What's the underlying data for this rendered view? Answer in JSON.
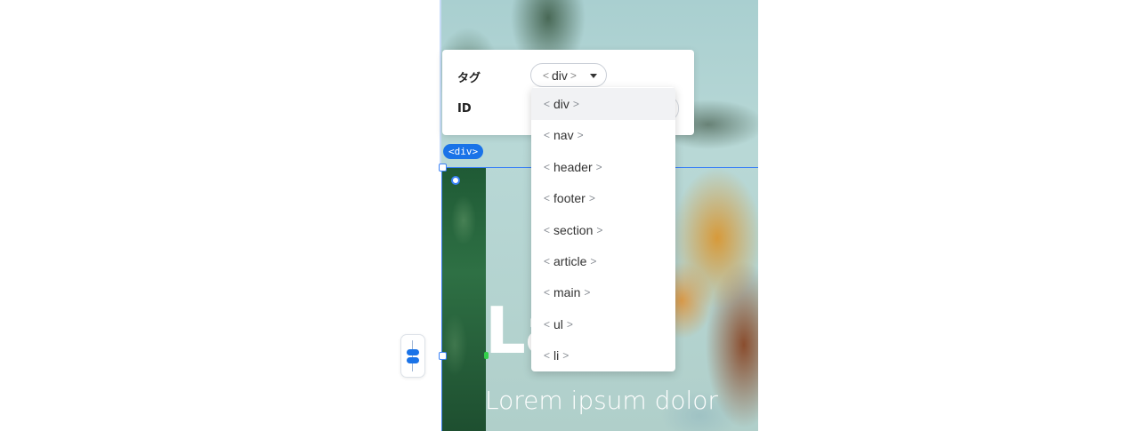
{
  "panel": {
    "tag_label": "タグ",
    "id_label": "ID",
    "selected_tag": "div",
    "bracket_open": "<",
    "bracket_close": ">"
  },
  "dropdown": {
    "options": [
      "div",
      "nav",
      "header",
      "footer",
      "section",
      "article",
      "main",
      "ul",
      "li"
    ],
    "active_index": 0
  },
  "element_badge": "<div>",
  "hero": {
    "headline": "La",
    "subtitle": "Lorem ipsum dolor"
  },
  "colors": {
    "accent": "#1a73e8",
    "selection": "#3b82f6"
  }
}
